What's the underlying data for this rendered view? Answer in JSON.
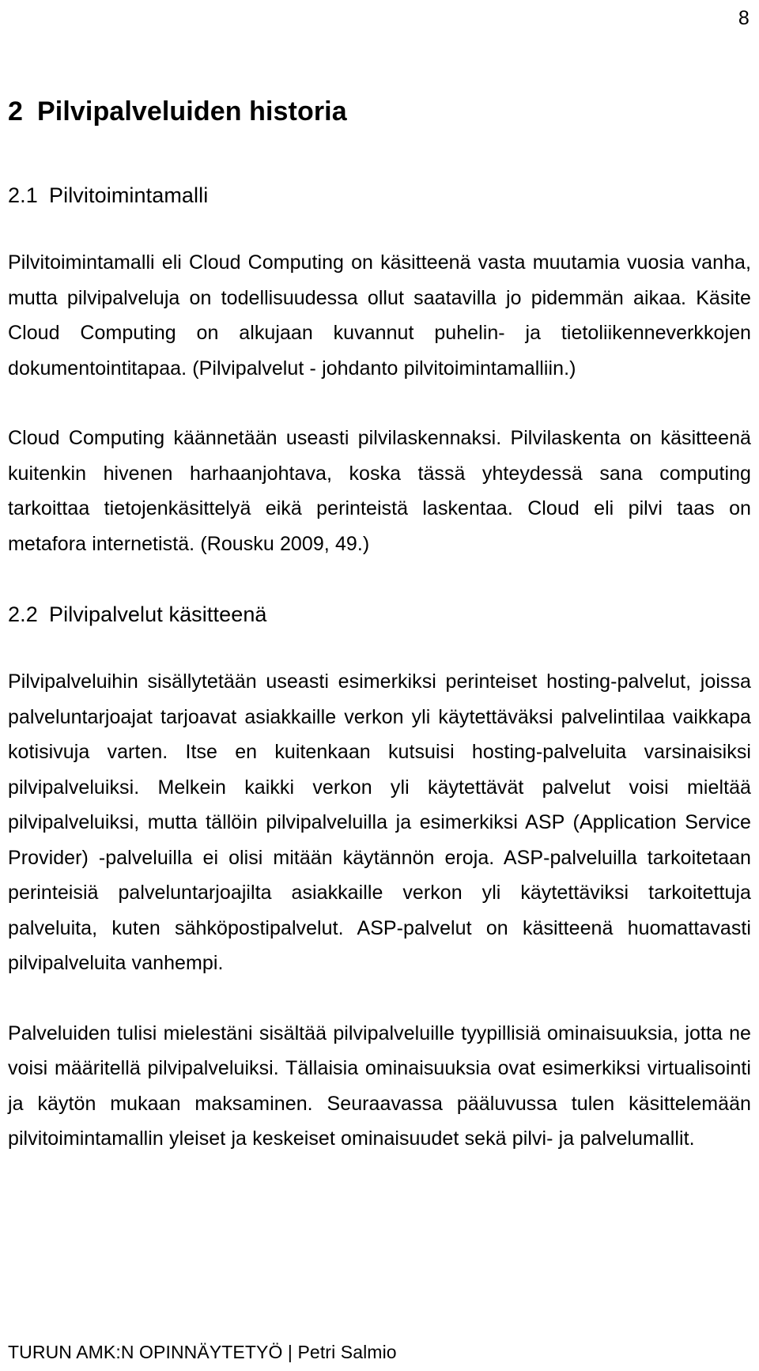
{
  "page": {
    "number": "8"
  },
  "chapter": {
    "number": "2",
    "title": "Pilvipalveluiden historia"
  },
  "sections": [
    {
      "number": "2.1",
      "title": "Pilvitoimintamalli",
      "paragraphs": [
        "Pilvitoimintamalli eli Cloud Computing on käsitteenä vasta muutamia vuosia vanha, mutta pilvipalveluja on todellisuudessa ollut saatavilla jo pidemmän aikaa. Käsite Cloud Computing on alkujaan kuvannut puhelin- ja tietoliikenneverkkojen dokumentointitapaa. (Pilvipalvelut - johdanto pilvitoimintamalliin.)",
        "Cloud Computing käännetään useasti pilvilaskennaksi. Pilvilaskenta on käsitteenä kuitenkin hivenen harhaanjohtava, koska tässä yhteydessä sana computing tarkoittaa tietojenkäsittelyä eikä perinteistä laskentaa. Cloud eli pilvi taas on metafora internetistä. (Rousku 2009, 49.)"
      ]
    },
    {
      "number": "2.2",
      "title": "Pilvipalvelut käsitteenä",
      "paragraphs": [
        "Pilvipalveluihin sisällytetään useasti esimerkiksi perinteiset hosting-palvelut, joissa palveluntarjoajat tarjoavat asiakkaille verkon yli käytettäväksi palvelintilaa vaikkapa kotisivuja varten. Itse en kuitenkaan kutsuisi hosting-palveluita varsinaisiksi pilvipalveluiksi. Melkein kaikki verkon yli käytettävät palvelut voisi mieltää pilvipalveluiksi, mutta tällöin pilvipalveluilla ja esimerkiksi ASP (Application Service Provider) -palveluilla ei olisi mitään käytännön eroja. ASP-palveluilla tarkoitetaan perinteisiä palveluntarjoajilta asiakkaille verkon yli käytettäviksi tarkoitettuja palveluita, kuten sähköpostipalvelut. ASP-palvelut on käsitteenä huomattavasti pilvipalveluita vanhempi.",
        "Palveluiden tulisi mielestäni sisältää pilvipalveluille tyypillisiä ominaisuuksia, jotta ne voisi määritellä pilvipalveluiksi. Tällaisia ominaisuuksia ovat esimerkiksi virtualisointi ja käytön mukaan maksaminen. Seuraavassa pääluvussa tulen käsittelemään pilvitoimintamallin yleiset ja keskeiset ominaisuudet sekä pilvi- ja palvelumallit."
      ]
    }
  ],
  "footer": {
    "text": "TURUN AMK:N OPINNÄYTETYÖ | Petri Salmio"
  }
}
